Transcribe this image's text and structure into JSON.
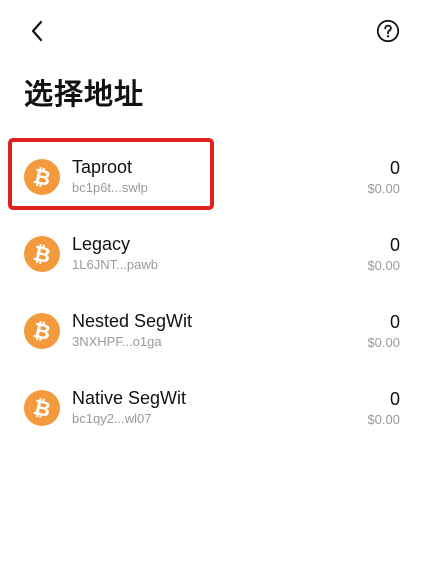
{
  "header": {
    "back_icon": "chevron-left-icon",
    "help_icon": "question-circle-icon"
  },
  "page": {
    "title": "选择地址"
  },
  "colors": {
    "bitcoin_orange": "#f39a3d",
    "highlight_red": "#e0221f",
    "secondary_text": "#9a9a9a"
  },
  "addresses": [
    {
      "name": "Taproot",
      "address": "bc1p6t...swlp",
      "amount": "0",
      "fiat": "$0.00",
      "icon": "bitcoin-icon",
      "highlighted": true
    },
    {
      "name": "Legacy",
      "address": "1L6JNT...pawb",
      "amount": "0",
      "fiat": "$0.00",
      "icon": "bitcoin-icon",
      "highlighted": false
    },
    {
      "name": "Nested SegWit",
      "address": "3NXHPF...o1ga",
      "amount": "0",
      "fiat": "$0.00",
      "icon": "bitcoin-icon",
      "highlighted": false
    },
    {
      "name": "Native SegWit",
      "address": "bc1qy2...wl07",
      "amount": "0",
      "fiat": "$0.00",
      "icon": "bitcoin-icon",
      "highlighted": false
    }
  ]
}
